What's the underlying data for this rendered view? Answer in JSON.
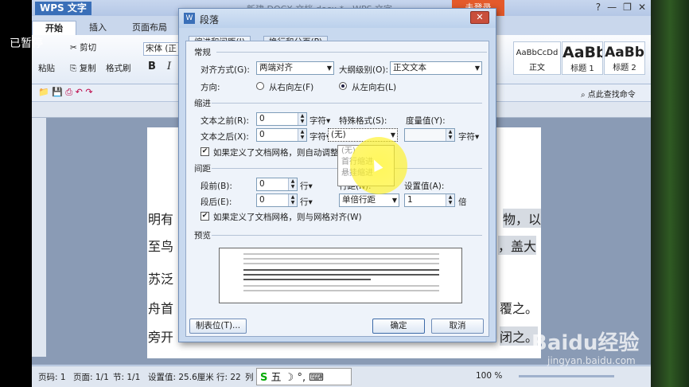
{
  "overlay": {
    "paused": "已暂停"
  },
  "app": {
    "name": "WPS 文字",
    "doc_title": "新建 DOCX 文档.docx * - WPS 文字",
    "login": "未登录",
    "tabs": [
      "开始",
      "插入",
      "页面布局"
    ],
    "font_name": "宋体 (正",
    "clipboard": {
      "paste": "粘贴",
      "cut": "剪切",
      "copy": "复制",
      "format_painter": "格式刷"
    },
    "styles": [
      {
        "sample": "AaBbCcDd",
        "name": "正文"
      },
      {
        "sample": "AaBb",
        "name": "标题 1"
      },
      {
        "sample": "AaBb",
        "name": "标题 2"
      }
    ],
    "search_cmd": "点此查找命令"
  },
  "document": {
    "lines": [
      {
        "left": "明有",
        "right": "物，以"
      },
      {
        "left": "至鸟",
        "right": "，盖大"
      },
      {
        "left": "苏泛",
        "right": ""
      },
      {
        "left": "舟首",
        "right": "覆之。"
      },
      {
        "left": "旁开",
        "right": "闭之。"
      }
    ]
  },
  "status": {
    "page": "页码: 1",
    "pages": "页面: 1/1",
    "section": "节: 1/1",
    "setting": "设置值: 25.6厘米",
    "row": "行: 22",
    "col": "列",
    "zoom": "100 %",
    "ime": "五"
  },
  "dialog": {
    "title": "段落",
    "tabs": [
      "缩进和间距(I)",
      "换行和分页(P)"
    ],
    "general": {
      "header": "常规",
      "align_label": "对齐方式(G):",
      "align_value": "两端对齐",
      "outline_label": "大纲级别(O):",
      "outline_value": "正文文本",
      "direction_label": "方向:",
      "rtl": "从右向左(F)",
      "ltr": "从左向右(L)"
    },
    "indent": {
      "header": "缩进",
      "before_label": "文本之前(R):",
      "before_value": "0",
      "after_label": "文本之后(X):",
      "after_value": "0",
      "unit": "字符",
      "special_label": "特殊格式(S):",
      "special_value": "(无)",
      "measure_label": "度量值(Y):",
      "measure_unit": "字符",
      "grid_check": "如果定义了文档网格，则自动调整"
    },
    "special_options": [
      "(无)",
      "首行缩进",
      "悬挂缩进"
    ],
    "spacing": {
      "header": "间距",
      "before_label": "段前(B):",
      "before_value": "0",
      "after_label": "段后(E):",
      "after_value": "0",
      "unit": "行",
      "line_label": "行距(N):",
      "line_value": "单倍行距",
      "set_label": "设置值(A):",
      "set_value": "1",
      "set_unit": "倍",
      "grid_check": "如果定义了文档网格，则与网格对齐(W)"
    },
    "preview_header": "预览",
    "tabs_button": "制表位(T)...",
    "ok": "确定",
    "cancel": "取消"
  },
  "watermark": {
    "logo": "Baidu经验",
    "url": "jingyan.baidu.com"
  },
  "colors": {
    "accent": "#3a6fb8",
    "login": "#e45a2b",
    "highlight": "#fff528"
  }
}
